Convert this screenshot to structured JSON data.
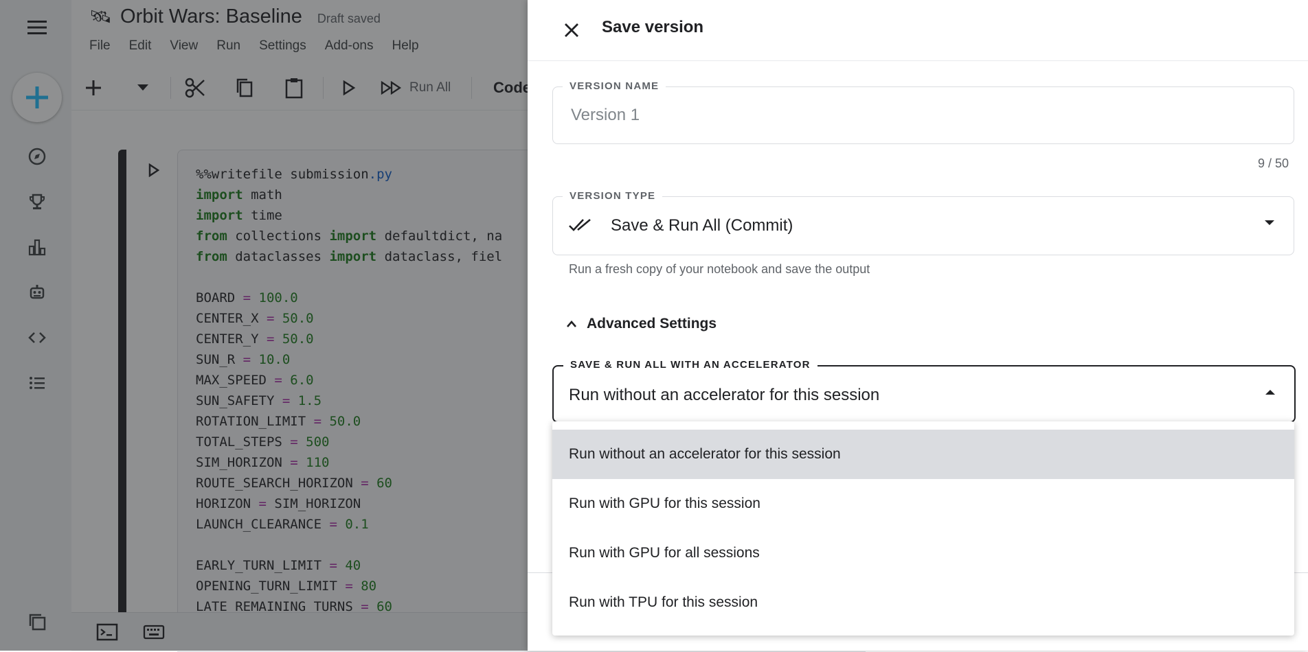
{
  "notebook": {
    "title": "Orbit Wars: Baseline",
    "status": "Draft saved",
    "menu": [
      "File",
      "Edit",
      "View",
      "Run",
      "Settings",
      "Add-ons",
      "Help"
    ],
    "toolbar": {
      "run_all_label": "Run All",
      "cell_type_label": "Code"
    },
    "code_lines": [
      [
        [
          "",
          "%%writefile submission"
        ],
        [
          "ext",
          ".py"
        ]
      ],
      [
        [
          "kw",
          "import"
        ],
        [
          "",
          " math"
        ]
      ],
      [
        [
          "kw",
          "import"
        ],
        [
          "",
          " time"
        ]
      ],
      [
        [
          "kw",
          "from"
        ],
        [
          "",
          " collections "
        ],
        [
          "kw",
          "import"
        ],
        [
          "",
          " defaultdict, na"
        ]
      ],
      [
        [
          "kw",
          "from"
        ],
        [
          "",
          " dataclasses "
        ],
        [
          "kw",
          "import"
        ],
        [
          "",
          " dataclass, fiel"
        ]
      ],
      [
        [
          "",
          ""
        ]
      ],
      [
        [
          "",
          "BOARD "
        ],
        [
          "op",
          "="
        ],
        [
          "num",
          " 100.0"
        ]
      ],
      [
        [
          "",
          "CENTER_X "
        ],
        [
          "op",
          "="
        ],
        [
          "num",
          " 50.0"
        ]
      ],
      [
        [
          "",
          "CENTER_Y "
        ],
        [
          "op",
          "="
        ],
        [
          "num",
          " 50.0"
        ]
      ],
      [
        [
          "",
          "SUN_R "
        ],
        [
          "op",
          "="
        ],
        [
          "num",
          " 10.0"
        ]
      ],
      [
        [
          "",
          "MAX_SPEED "
        ],
        [
          "op",
          "="
        ],
        [
          "num",
          " 6.0"
        ]
      ],
      [
        [
          "",
          "SUN_SAFETY "
        ],
        [
          "op",
          "="
        ],
        [
          "num",
          " 1.5"
        ]
      ],
      [
        [
          "",
          "ROTATION_LIMIT "
        ],
        [
          "op",
          "="
        ],
        [
          "num",
          " 50.0"
        ]
      ],
      [
        [
          "",
          "TOTAL_STEPS "
        ],
        [
          "op",
          "="
        ],
        [
          "num",
          " 500"
        ]
      ],
      [
        [
          "",
          "SIM_HORIZON "
        ],
        [
          "op",
          "="
        ],
        [
          "num",
          " 110"
        ]
      ],
      [
        [
          "",
          "ROUTE_SEARCH_HORIZON "
        ],
        [
          "op",
          "="
        ],
        [
          "num",
          " 60"
        ]
      ],
      [
        [
          "",
          "HORIZON "
        ],
        [
          "op",
          "="
        ],
        [
          "",
          " SIM_HORIZON"
        ]
      ],
      [
        [
          "",
          "LAUNCH_CLEARANCE "
        ],
        [
          "op",
          "="
        ],
        [
          "num",
          " 0.1"
        ]
      ],
      [
        [
          "",
          ""
        ]
      ],
      [
        [
          "",
          "EARLY_TURN_LIMIT "
        ],
        [
          "op",
          "="
        ],
        [
          "num",
          " 40"
        ]
      ],
      [
        [
          "",
          "OPENING_TURN_LIMIT "
        ],
        [
          "op",
          "="
        ],
        [
          "num",
          " 80"
        ]
      ],
      [
        [
          "",
          "LATE_REMAINING_TURNS "
        ],
        [
          "op",
          "="
        ],
        [
          "num",
          " 60"
        ]
      ]
    ]
  },
  "save_panel": {
    "title": "Save version",
    "version_name": {
      "label": "VERSION NAME",
      "placeholder": "Version 1",
      "value": "",
      "counter": "9 / 50"
    },
    "version_type": {
      "label": "VERSION TYPE",
      "value": "Save & Run All (Commit)",
      "helper": "Run a fresh copy of your notebook and save the output"
    },
    "advanced_label": "Advanced Settings",
    "accelerator": {
      "label": "SAVE & RUN ALL WITH AN ACCELERATOR",
      "value": "Run without an accelerator for this session",
      "options": [
        "Run without an accelerator for this session",
        "Run with GPU for this session",
        "Run with GPU for all sessions",
        "Run with TPU for this session"
      ],
      "selected_index": 0
    }
  },
  "colors": {
    "accent": "#20beff",
    "scrim": "#202124",
    "selected_option": "#dadce0"
  }
}
